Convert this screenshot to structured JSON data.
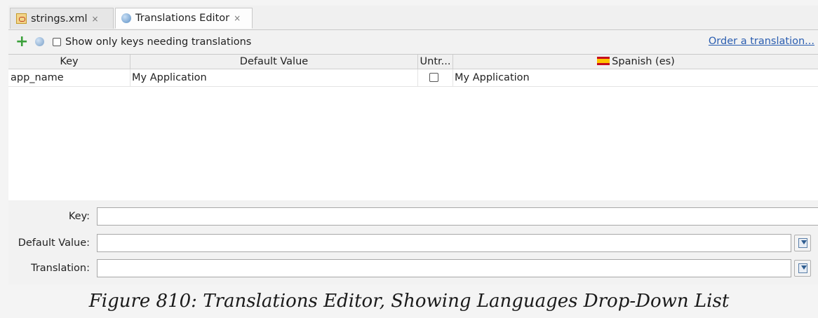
{
  "tabs": [
    {
      "label": "strings.xml",
      "icon": "xml-file-icon",
      "close": "×"
    },
    {
      "label": "Translations Editor",
      "icon": "globe-icon",
      "close": "×"
    }
  ],
  "toolbar": {
    "show_only_label": "Show only keys needing translations",
    "show_only_checked": false,
    "order_link": "Order a translation..."
  },
  "table": {
    "columns": [
      "Key",
      "Default Value",
      "Untr...",
      "Spanish (es)"
    ],
    "rows": [
      {
        "key": "app_name",
        "default_value": "My Application",
        "untranslatable": false,
        "spanish": "My Application"
      }
    ]
  },
  "form": {
    "key_label": "Key:",
    "default_value_label": "Default Value:",
    "translation_label": "Translation:",
    "key_value": "",
    "default_value_value": "",
    "translation_value": ""
  },
  "caption": "Figure 810: Translations Editor, Showing Languages Drop-Down List",
  "colors": {
    "link": "#2a5db0",
    "add_icon": "#3aa03a"
  }
}
